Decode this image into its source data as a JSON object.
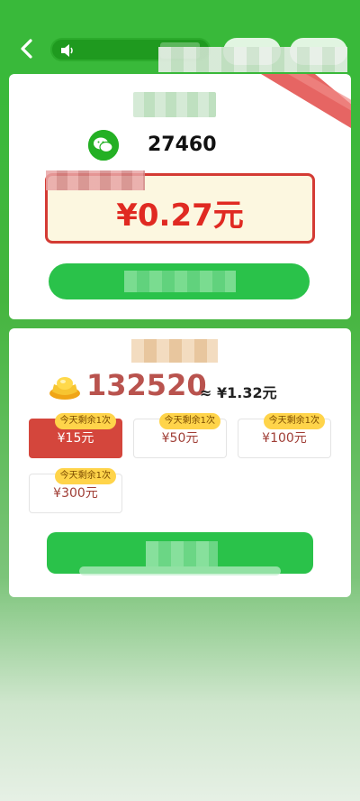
{
  "topbar": {
    "back_icon": "chevron-left-icon",
    "speaker_icon": "speaker-icon"
  },
  "card1": {
    "wechat_icon": "wechat-icon",
    "wechat_value": "27460",
    "cash_amount": "¥0.27元"
  },
  "card2": {
    "coin_icon": "gold-ingot-icon",
    "coin_count": "132520",
    "coin_value": "≈ ¥1.32元",
    "options": [
      {
        "label": "¥15元",
        "badge": "今天剩余1次",
        "selected": true
      },
      {
        "label": "¥50元",
        "badge": "今天剩余1次",
        "selected": false
      },
      {
        "label": "¥100元",
        "badge": "今天剩余1次",
        "selected": false
      },
      {
        "label": "¥300元",
        "badge": "今天剩余1次",
        "selected": false
      }
    ]
  },
  "colors": {
    "brand_green": "#39b93a",
    "accent_red": "#e02a22",
    "button_green": "#2ac24a",
    "badge_yellow": "#ffd44a"
  }
}
